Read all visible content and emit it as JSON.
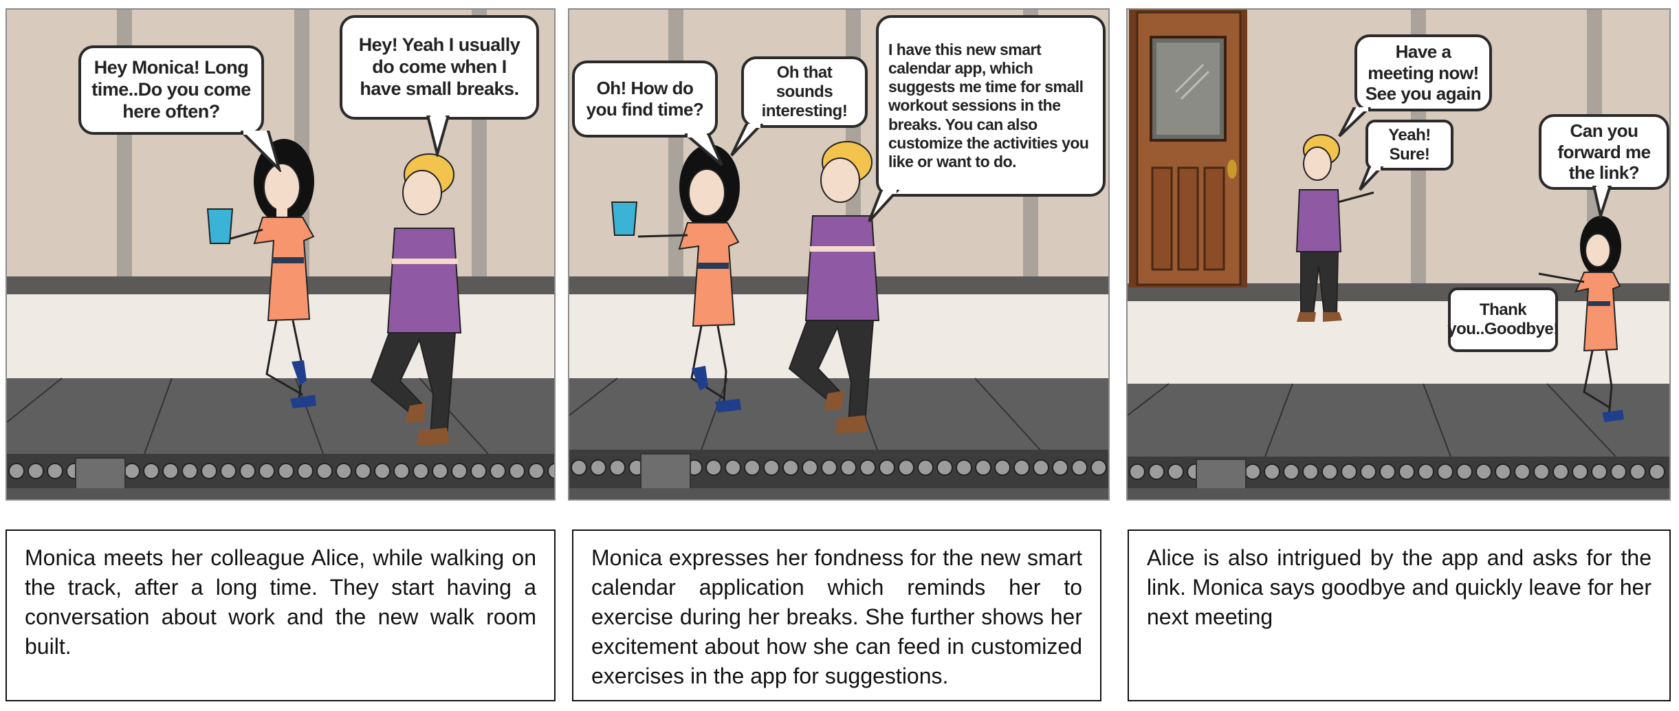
{
  "panels": [
    {
      "bubbles": {
        "monica": "Hey Monica! Long time..Do you come here often?",
        "alice": "Hey! Yeah I usually do come when I have small breaks."
      },
      "caption": "Monica meets her colleague Alice, while walking on the track, after a long time. They start having a conversation about work and the new walk room built."
    },
    {
      "bubbles": {
        "monica": "Oh! How do you find time?",
        "reply": "Oh that sounds interesting!",
        "alice": "I have this new smart calendar app, which suggests me time for small workout sessions in the breaks. You can also customize the activities you like or want to do."
      },
      "caption": "Monica expresses her fondness for the new smart calendar application which reminds her to exercise during her breaks. She further shows her excitement about how she can feed in customized exercises in the app for suggestions."
    },
    {
      "bubbles": {
        "meeting": "Have a meeting now! See you again",
        "sure": "Yeah! Sure!",
        "forward": "Can you forward me the link?",
        "thanks": "Thank you..Goodbye!"
      },
      "caption": "Alice is also intrigued by the app and asks for the link. Monica says goodbye and quickly leave for her next meeting"
    }
  ],
  "colors": {
    "wall": "#d8cbbd",
    "beam": "#a9a39b",
    "floor": "#5f5f5f",
    "monica_dress": "#f7956f",
    "alice_top": "#8f5aa3",
    "alice_pants": "#2f2f2f",
    "door": "#9a5a32",
    "glass": "#3bb3d6"
  },
  "icons": [
    "walking-woman-figure",
    "glass-of-water-icon",
    "door-icon",
    "conveyor-rollers"
  ]
}
